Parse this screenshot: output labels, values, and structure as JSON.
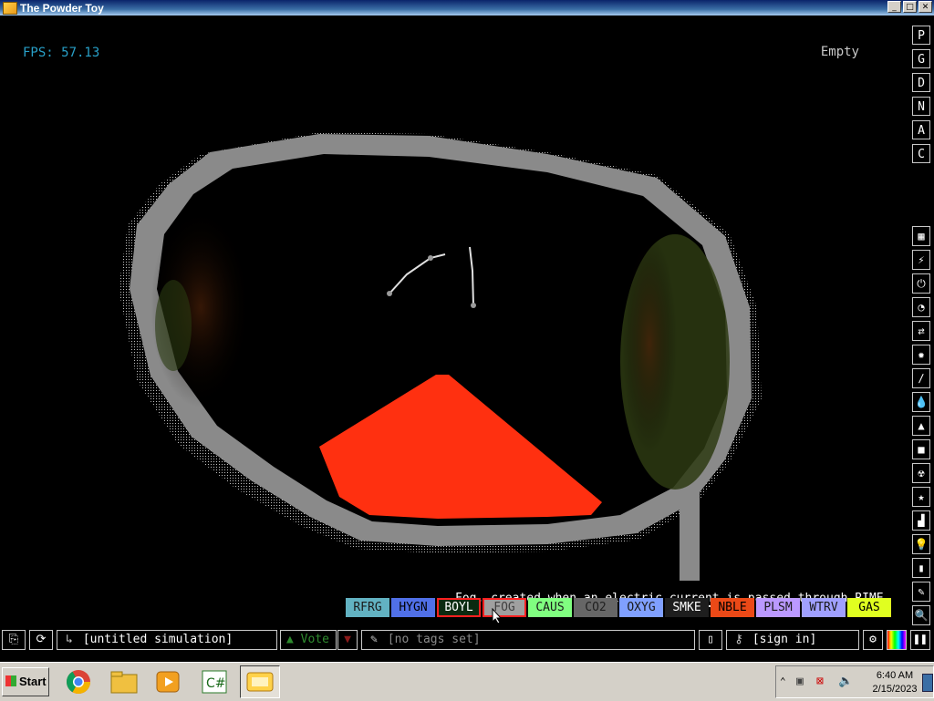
{
  "window": {
    "title": "The Powder Toy",
    "btn_min": "_",
    "btn_max": "□",
    "btn_close": "✕"
  },
  "hud": {
    "fps": "FPS: 57.13",
    "hover_element": "Empty",
    "tooltip_pre": "Fog, created when an electric ",
    "tooltip_cur": "current",
    "tooltip_post": " is passed through RIME."
  },
  "side_top": [
    "P",
    "G",
    "D",
    "N",
    "A",
    "C"
  ],
  "elements": [
    {
      "label": "RFRG",
      "bg": "#62b2c2",
      "fg": "#1a1a1a"
    },
    {
      "label": "HYGN",
      "bg": "#5070e8",
      "fg": "#000000"
    },
    {
      "label": "BOYL",
      "bg": "#0a2a10",
      "fg": "#ffffff"
    },
    {
      "label": "FOG",
      "bg": "#a0a0a0",
      "fg": "#404040"
    },
    {
      "label": "CAUS",
      "bg": "#80ff80",
      "fg": "#1a1a1a"
    },
    {
      "label": "CO2",
      "bg": "#666666",
      "fg": "#202020"
    },
    {
      "label": "OXYG",
      "bg": "#80a0ff",
      "fg": "#1a1a1a"
    },
    {
      "label": "SMKE",
      "bg": "#1e1e1e",
      "fg": "#ffffff"
    },
    {
      "label": "NBLE",
      "bg": "#eb4917",
      "fg": "#000000"
    },
    {
      "label": "PLSM",
      "bg": "#bb99ff",
      "fg": "#1a1a1a"
    },
    {
      "label": "WTRV",
      "bg": "#a0a0ff",
      "fg": "#1a1a1a"
    },
    {
      "label": "GAS",
      "bg": "#e0ff20",
      "fg": "#000000"
    }
  ],
  "bottom": {
    "sim_name": "[untitled simulation]",
    "vote": "Vote",
    "tags": "[no tags set]",
    "signin": "[sign in]"
  },
  "taskbar": {
    "start": "Start",
    "time": "6:40 AM",
    "date": "2/15/2023"
  }
}
